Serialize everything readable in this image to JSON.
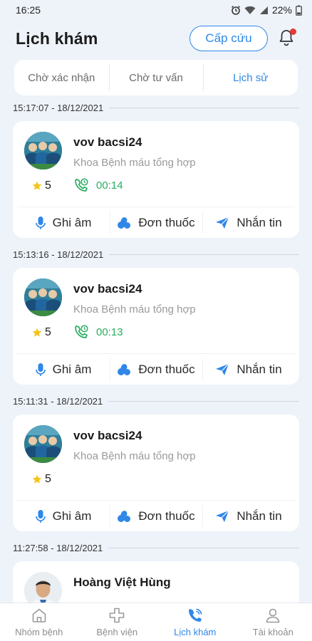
{
  "status_bar": {
    "time": "16:25",
    "battery": "22%"
  },
  "header": {
    "title": "Lịch khám",
    "emergency_label": "Cấp cứu"
  },
  "tabs": [
    {
      "label": "Chờ xác nhận",
      "active": false
    },
    {
      "label": "Chờ tư vấn",
      "active": false
    },
    {
      "label": "Lịch sử",
      "active": true
    }
  ],
  "appointments": [
    {
      "timestamp": "15:17:07 - 18/12/2021",
      "doctor": "vov bacsi24",
      "department": "Khoa Bệnh máu tổng hợp",
      "rating": "5",
      "duration": "00:14"
    },
    {
      "timestamp": "15:13:16 - 18/12/2021",
      "doctor": "vov bacsi24",
      "department": "Khoa Bệnh máu tổng hợp",
      "rating": "5",
      "duration": "00:13"
    },
    {
      "timestamp": "15:11:31 - 18/12/2021",
      "doctor": "vov bacsi24",
      "department": "Khoa Bệnh máu tổng hợp",
      "rating": "5",
      "duration": ""
    },
    {
      "timestamp": "11:27:58 - 18/12/2021",
      "doctor": "Hoàng Việt Hùng"
    }
  ],
  "actions": {
    "record": "Ghi âm",
    "prescription": "Đơn thuốc",
    "message": "Nhắn tin"
  },
  "nav": [
    {
      "label": "Nhóm bệnh",
      "icon": "home-icon"
    },
    {
      "label": "Bệnh viện",
      "icon": "hospital-cross-icon"
    },
    {
      "label": "Lịch khám",
      "icon": "phone-icon"
    },
    {
      "label": "Tài khoản",
      "icon": "user-icon"
    }
  ],
  "colors": {
    "accent": "#2f87e8",
    "call_green": "#27ae60",
    "star": "#f5c518",
    "notification": "#e53935"
  }
}
